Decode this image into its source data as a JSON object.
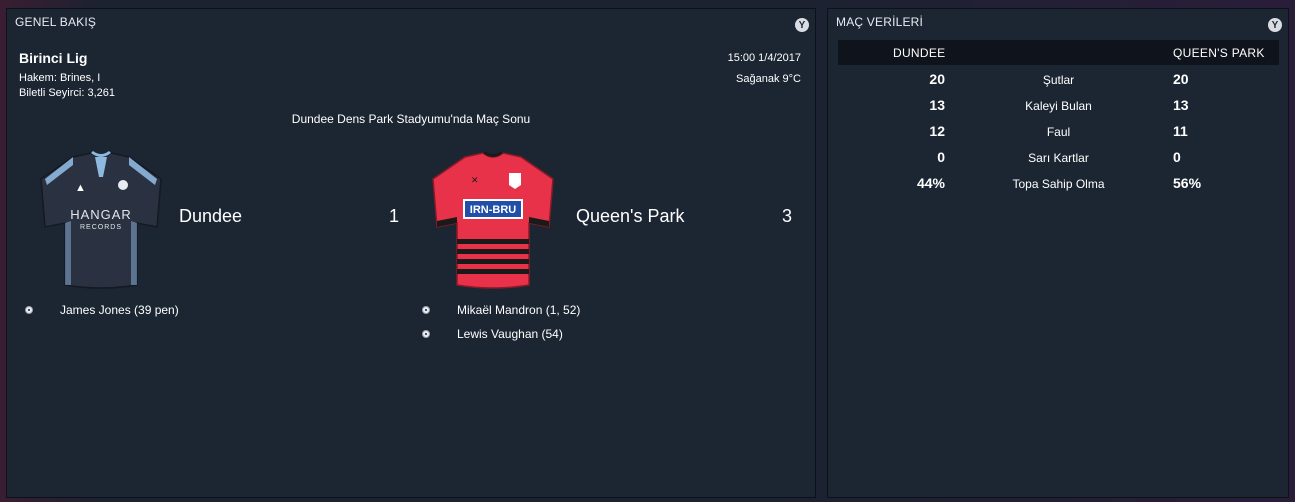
{
  "overview": {
    "title": "GENEL BAKIŞ",
    "competition": "Birinci Lig",
    "referee": "Hakem: Brines, I",
    "attendance": "Biletli Seyirci: 3,261",
    "kickoff": "15:00 1/4/2017",
    "weather": "Sağanak 9°C",
    "venue_result": "Dundee Dens Park Stadyumu'nda Maç Sonu",
    "home": {
      "name": "Dundee",
      "score": "1",
      "kit_sponsor_1": "HANGAR",
      "kit_sponsor_2": "RECORDS",
      "scorers": [
        "James Jones (39 pen)"
      ]
    },
    "away": {
      "name": "Queen's Park",
      "score": "3",
      "kit_sponsor": "IRN-BRU",
      "scorers": [
        "Mikaël Mandron (1, 52)",
        "Lewis Vaughan (54)"
      ]
    }
  },
  "stats": {
    "title": "MAÇ VERİLERİ",
    "home_label": "DUNDEE",
    "away_label": "QUEEN'S PARK",
    "rows": [
      {
        "label": "Şutlar",
        "home": "20",
        "away": "20"
      },
      {
        "label": "Kaleyi Bulan",
        "home": "13",
        "away": "13"
      },
      {
        "label": "Faul",
        "home": "12",
        "away": "11"
      },
      {
        "label": "Sarı Kartlar",
        "home": "0",
        "away": "0"
      },
      {
        "label": "Topa Sahip Olma",
        "home": "44%",
        "away": "56%"
      }
    ]
  },
  "icons": {
    "panel_menu": "chevron-down-circle-icon",
    "goal": "football-icon"
  },
  "colors": {
    "panel_bg": "#1c2532",
    "home_kit": "#2a3140",
    "home_trim": "#8fb8df",
    "away_kit": "#e8324a"
  },
  "menu_glyph": "Y"
}
